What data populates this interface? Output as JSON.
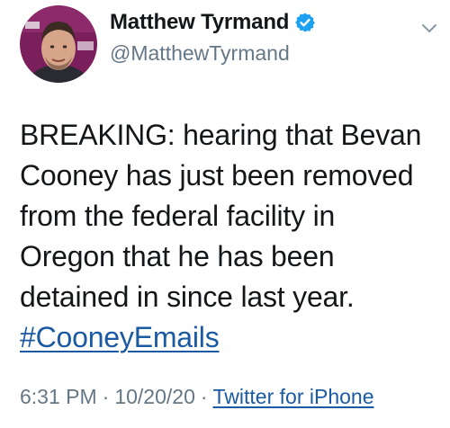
{
  "tweet": {
    "author": {
      "display_name": "Matthew Tyrmand",
      "handle": "@MatthewTyrmand",
      "verified": true
    },
    "text_lines": [
      "BREAKING: hearing that Bevan",
      "Cooney has just been removed",
      "from the federal facility in",
      "Oregon that he has been",
      "detained in since last year."
    ],
    "hashtag": "#CooneyEmails",
    "meta": {
      "time": "6:31 PM",
      "separator": "·",
      "date": "10/20/20",
      "source": "Twitter for iPhone"
    },
    "icons": {
      "verified": "verified-badge-icon",
      "menu": "chevron-down-icon"
    },
    "colors": {
      "link": "#1b5aa3",
      "verified": "#1da1f2",
      "secondary_text": "#657786",
      "avatar_bg": "#7a1e5c"
    }
  }
}
